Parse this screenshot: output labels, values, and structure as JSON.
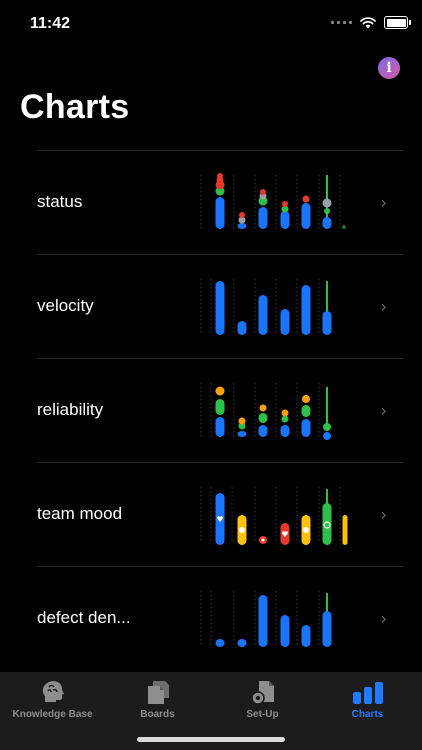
{
  "status_bar": {
    "time": "11:42"
  },
  "header": {
    "title": "Charts",
    "info_icon": "info-icon"
  },
  "colors": {
    "blue": "#1b74ff",
    "green": "#2fbf4a",
    "red": "#e23b2e",
    "yellow": "#ffc20a",
    "orange": "#ff9f0a",
    "gray": "#9aa0a6",
    "accent": "#1f7bff"
  },
  "rows": [
    {
      "label": "status",
      "chart": "status"
    },
    {
      "label": "velocity",
      "chart": "velocity"
    },
    {
      "label": "reliability",
      "chart": "reliability"
    },
    {
      "label": "team mood",
      "chart": "mood"
    },
    {
      "label": "defect den...",
      "chart": "defect"
    }
  ],
  "tabs": [
    {
      "label": "Knowledge Base",
      "icon": "brain-head-icon"
    },
    {
      "label": "Boards",
      "icon": "boards-icon"
    },
    {
      "label": "Set-Up",
      "icon": "setup-gear-icon"
    },
    {
      "label": "Charts",
      "icon": "bar-chart-icon",
      "active": true
    }
  ]
}
